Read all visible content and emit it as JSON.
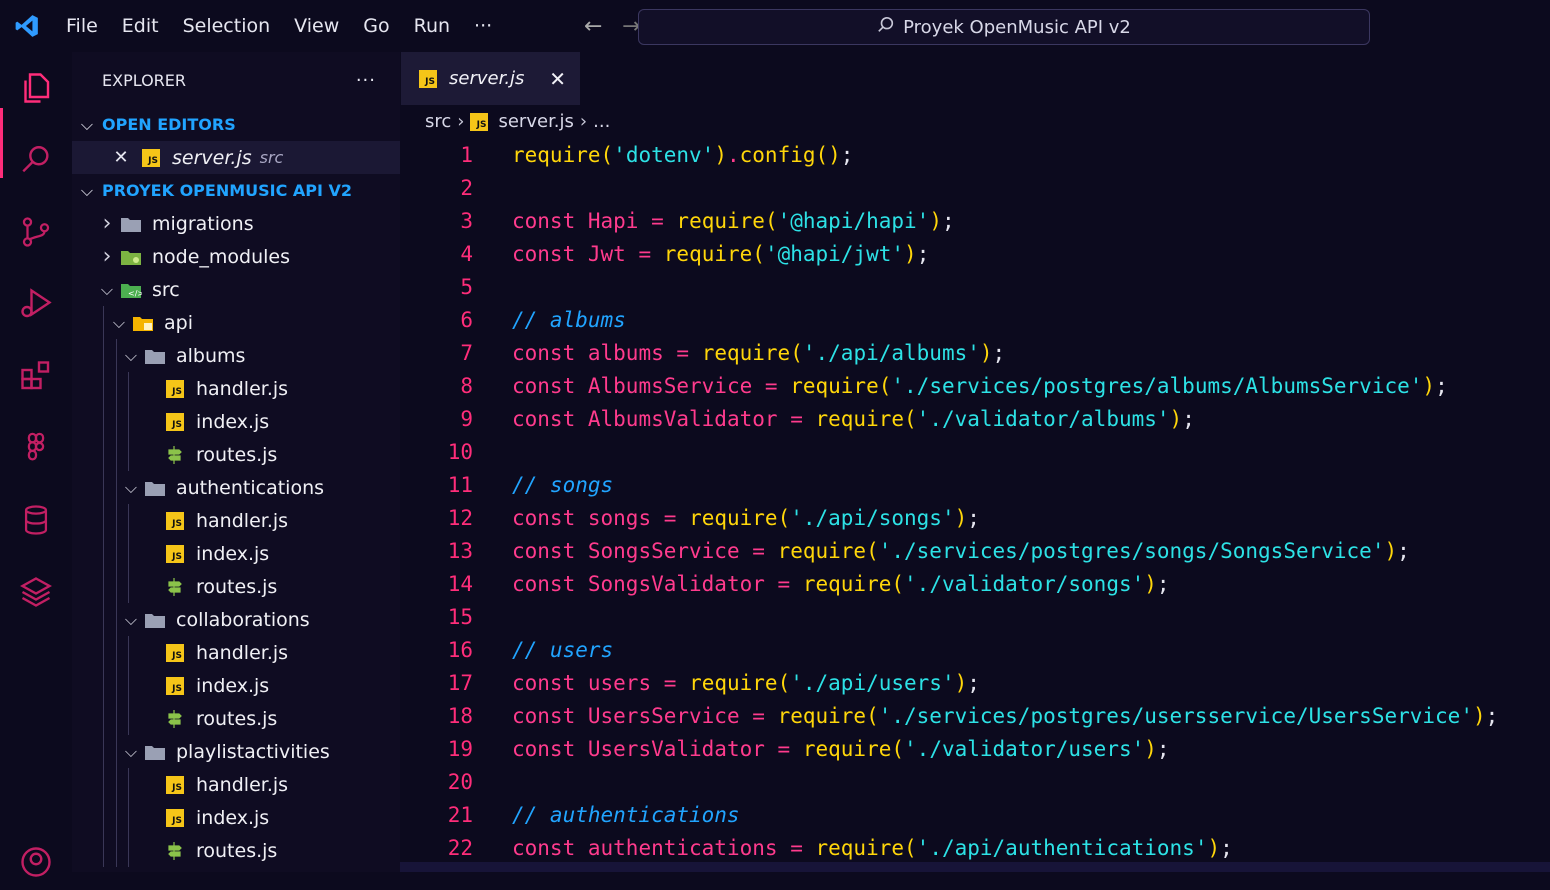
{
  "titlebar": {
    "menu": [
      "File",
      "Edit",
      "Selection",
      "View",
      "Go",
      "Run",
      "···"
    ],
    "search_text": "Proyek OpenMusic API v2"
  },
  "activitybar": {
    "icons": [
      "explorer-icon",
      "search-icon",
      "source-control-icon",
      "run-debug-icon",
      "extensions-icon",
      "figma-icon",
      "database-icon",
      "layers-icon",
      "account-icon"
    ]
  },
  "sidebar": {
    "title": "EXPLORER",
    "more": "···",
    "open_editors_label": "OPEN EDITORS",
    "open_editor": {
      "name": "server.js",
      "folder": "src"
    },
    "project_label": "PROYEK OPENMUSIC API V2",
    "tree": [
      {
        "depth": 0,
        "type": "folder",
        "open": false,
        "name": "migrations",
        "icon": "folder"
      },
      {
        "depth": 0,
        "type": "folder",
        "open": false,
        "name": "node_modules",
        "icon": "node"
      },
      {
        "depth": 0,
        "type": "folder",
        "open": true,
        "name": "src",
        "icon": "src"
      },
      {
        "depth": 1,
        "type": "folder",
        "open": true,
        "name": "api",
        "icon": "api"
      },
      {
        "depth": 2,
        "type": "folder",
        "open": true,
        "name": "albums",
        "icon": "folder"
      },
      {
        "depth": 3,
        "type": "file",
        "name": "handler.js",
        "icon": "js"
      },
      {
        "depth": 3,
        "type": "file",
        "name": "index.js",
        "icon": "js"
      },
      {
        "depth": 3,
        "type": "file",
        "name": "routes.js",
        "icon": "routes"
      },
      {
        "depth": 2,
        "type": "folder",
        "open": true,
        "name": "authentications",
        "icon": "folder"
      },
      {
        "depth": 3,
        "type": "file",
        "name": "handler.js",
        "icon": "js"
      },
      {
        "depth": 3,
        "type": "file",
        "name": "index.js",
        "icon": "js"
      },
      {
        "depth": 3,
        "type": "file",
        "name": "routes.js",
        "icon": "routes"
      },
      {
        "depth": 2,
        "type": "folder",
        "open": true,
        "name": "collaborations",
        "icon": "folder"
      },
      {
        "depth": 3,
        "type": "file",
        "name": "handler.js",
        "icon": "js"
      },
      {
        "depth": 3,
        "type": "file",
        "name": "index.js",
        "icon": "js"
      },
      {
        "depth": 3,
        "type": "file",
        "name": "routes.js",
        "icon": "routes"
      },
      {
        "depth": 2,
        "type": "folder",
        "open": true,
        "name": "playlistactivities",
        "icon": "folder"
      },
      {
        "depth": 3,
        "type": "file",
        "name": "handler.js",
        "icon": "js"
      },
      {
        "depth": 3,
        "type": "file",
        "name": "index.js",
        "icon": "js"
      },
      {
        "depth": 3,
        "type": "file",
        "name": "routes.js",
        "icon": "routes"
      }
    ]
  },
  "editor": {
    "tab": {
      "name": "server.js",
      "close": "✕"
    },
    "breadcrumb": {
      "folder": "src",
      "file": "server.js",
      "more": "..."
    },
    "lines": [
      {
        "n": "1",
        "tokens": [
          [
            "fn",
            "require"
          ],
          [
            "paren",
            "("
          ],
          [
            "str",
            "'dotenv'"
          ],
          [
            "paren",
            ")"
          ],
          [
            "op",
            "."
          ],
          [
            "fn",
            "config"
          ],
          [
            "paren",
            "()"
          ],
          [
            "punc",
            ";"
          ]
        ]
      },
      {
        "n": "2",
        "tokens": []
      },
      {
        "n": "3",
        "tokens": [
          [
            "kw",
            "const"
          ],
          [
            "punc",
            " "
          ],
          [
            "var",
            "Hapi"
          ],
          [
            "punc",
            " "
          ],
          [
            "op",
            "="
          ],
          [
            "punc",
            " "
          ],
          [
            "fn",
            "require"
          ],
          [
            "paren",
            "("
          ],
          [
            "str",
            "'@hapi/hapi'"
          ],
          [
            "paren",
            ")"
          ],
          [
            "punc",
            ";"
          ]
        ]
      },
      {
        "n": "4",
        "tokens": [
          [
            "kw",
            "const"
          ],
          [
            "punc",
            " "
          ],
          [
            "var",
            "Jwt"
          ],
          [
            "punc",
            " "
          ],
          [
            "op",
            "="
          ],
          [
            "punc",
            " "
          ],
          [
            "fn",
            "require"
          ],
          [
            "paren",
            "("
          ],
          [
            "str",
            "'@hapi/jwt'"
          ],
          [
            "paren",
            ")"
          ],
          [
            "punc",
            ";"
          ]
        ]
      },
      {
        "n": "5",
        "tokens": []
      },
      {
        "n": "6",
        "tokens": [
          [
            "cm",
            "// albums"
          ]
        ]
      },
      {
        "n": "7",
        "tokens": [
          [
            "kw",
            "const"
          ],
          [
            "punc",
            " "
          ],
          [
            "var",
            "albums"
          ],
          [
            "punc",
            " "
          ],
          [
            "op",
            "="
          ],
          [
            "punc",
            " "
          ],
          [
            "fn",
            "require"
          ],
          [
            "paren",
            "("
          ],
          [
            "str",
            "'./api/albums'"
          ],
          [
            "paren",
            ")"
          ],
          [
            "punc",
            ";"
          ]
        ]
      },
      {
        "n": "8",
        "tokens": [
          [
            "kw",
            "const"
          ],
          [
            "punc",
            " "
          ],
          [
            "var",
            "AlbumsService"
          ],
          [
            "punc",
            " "
          ],
          [
            "op",
            "="
          ],
          [
            "punc",
            " "
          ],
          [
            "fn",
            "require"
          ],
          [
            "paren",
            "("
          ],
          [
            "str",
            "'./services/postgres/albums/AlbumsService'"
          ],
          [
            "paren",
            ")"
          ],
          [
            "punc",
            ";"
          ]
        ]
      },
      {
        "n": "9",
        "tokens": [
          [
            "kw",
            "const"
          ],
          [
            "punc",
            " "
          ],
          [
            "var",
            "AlbumsValidator"
          ],
          [
            "punc",
            " "
          ],
          [
            "op",
            "="
          ],
          [
            "punc",
            " "
          ],
          [
            "fn",
            "require"
          ],
          [
            "paren",
            "("
          ],
          [
            "str",
            "'./validator/albums'"
          ],
          [
            "paren",
            ")"
          ],
          [
            "punc",
            ";"
          ]
        ]
      },
      {
        "n": "10",
        "tokens": []
      },
      {
        "n": "11",
        "tokens": [
          [
            "cm",
            "// songs"
          ]
        ]
      },
      {
        "n": "12",
        "tokens": [
          [
            "kw",
            "const"
          ],
          [
            "punc",
            " "
          ],
          [
            "var",
            "songs"
          ],
          [
            "punc",
            " "
          ],
          [
            "op",
            "="
          ],
          [
            "punc",
            " "
          ],
          [
            "fn",
            "require"
          ],
          [
            "paren",
            "("
          ],
          [
            "str",
            "'./api/songs'"
          ],
          [
            "paren",
            ")"
          ],
          [
            "punc",
            ";"
          ]
        ]
      },
      {
        "n": "13",
        "tokens": [
          [
            "kw",
            "const"
          ],
          [
            "punc",
            " "
          ],
          [
            "var",
            "SongsService"
          ],
          [
            "punc",
            " "
          ],
          [
            "op",
            "="
          ],
          [
            "punc",
            " "
          ],
          [
            "fn",
            "require"
          ],
          [
            "paren",
            "("
          ],
          [
            "str",
            "'./services/postgres/songs/SongsService'"
          ],
          [
            "paren",
            ")"
          ],
          [
            "punc",
            ";"
          ]
        ]
      },
      {
        "n": "14",
        "tokens": [
          [
            "kw",
            "const"
          ],
          [
            "punc",
            " "
          ],
          [
            "var",
            "SongsValidator"
          ],
          [
            "punc",
            " "
          ],
          [
            "op",
            "="
          ],
          [
            "punc",
            " "
          ],
          [
            "fn",
            "require"
          ],
          [
            "paren",
            "("
          ],
          [
            "str",
            "'./validator/songs'"
          ],
          [
            "paren",
            ")"
          ],
          [
            "punc",
            ";"
          ]
        ]
      },
      {
        "n": "15",
        "tokens": []
      },
      {
        "n": "16",
        "tokens": [
          [
            "cm",
            "// users"
          ]
        ]
      },
      {
        "n": "17",
        "tokens": [
          [
            "kw",
            "const"
          ],
          [
            "punc",
            " "
          ],
          [
            "var",
            "users"
          ],
          [
            "punc",
            " "
          ],
          [
            "op",
            "="
          ],
          [
            "punc",
            " "
          ],
          [
            "fn",
            "require"
          ],
          [
            "paren",
            "("
          ],
          [
            "str",
            "'./api/users'"
          ],
          [
            "paren",
            ")"
          ],
          [
            "punc",
            ";"
          ]
        ]
      },
      {
        "n": "18",
        "tokens": [
          [
            "kw",
            "const"
          ],
          [
            "punc",
            " "
          ],
          [
            "var",
            "UsersService"
          ],
          [
            "punc",
            " "
          ],
          [
            "op",
            "="
          ],
          [
            "punc",
            " "
          ],
          [
            "fn",
            "require"
          ],
          [
            "paren",
            "("
          ],
          [
            "str",
            "'./services/postgres/usersservice/UsersService'"
          ],
          [
            "paren",
            ")"
          ],
          [
            "punc",
            ";"
          ]
        ]
      },
      {
        "n": "19",
        "tokens": [
          [
            "kw",
            "const"
          ],
          [
            "punc",
            " "
          ],
          [
            "var",
            "UsersValidator"
          ],
          [
            "punc",
            " "
          ],
          [
            "op",
            "="
          ],
          [
            "punc",
            " "
          ],
          [
            "fn",
            "require"
          ],
          [
            "paren",
            "("
          ],
          [
            "str",
            "'./validator/users'"
          ],
          [
            "paren",
            ")"
          ],
          [
            "punc",
            ";"
          ]
        ]
      },
      {
        "n": "20",
        "tokens": []
      },
      {
        "n": "21",
        "tokens": [
          [
            "cm",
            "// authentications"
          ]
        ]
      },
      {
        "n": "22",
        "tokens": [
          [
            "kw",
            "const"
          ],
          [
            "punc",
            " "
          ],
          [
            "var",
            "authentications"
          ],
          [
            "punc",
            " "
          ],
          [
            "op",
            "="
          ],
          [
            "punc",
            " "
          ],
          [
            "fn",
            "require"
          ],
          [
            "paren",
            "("
          ],
          [
            "str",
            "'./api/authentications'"
          ],
          [
            "paren",
            ")"
          ],
          [
            "punc",
            ";"
          ]
        ]
      }
    ]
  },
  "colors": {
    "background": "#0c0a1e",
    "accent_pink": "#ff3b8d",
    "accent_blue": "#21a4ff",
    "string_cyan": "#2de2e6",
    "function_yellow": "#ffd60a"
  }
}
